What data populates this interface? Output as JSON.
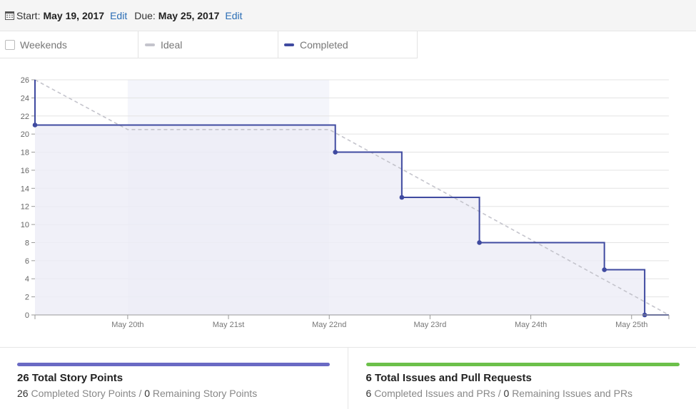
{
  "header": {
    "start_label": "Start:",
    "start_value": "May 19, 2017",
    "start_edit": "Edit",
    "due_label": "Due:",
    "due_value": "May 25, 2017",
    "due_edit": "Edit",
    "icon": "calendar-icon"
  },
  "legend": {
    "weekends": "Weekends",
    "ideal": "Ideal",
    "completed": "Completed"
  },
  "colors": {
    "completed": "#3f4aa0",
    "completed_fill": "#ececf6",
    "ideal": "#c4c4cc",
    "weekend_band": "#f4f5fb",
    "grid": "#e3e3e3",
    "story_bar": "#6a6ac4",
    "issues_bar": "#6cc04a"
  },
  "chart_data": {
    "type": "line",
    "y_ticks": [
      "0",
      "2",
      "4",
      "6",
      "8",
      "10",
      "12",
      "14",
      "16",
      "18",
      "20",
      "22",
      "24",
      "26"
    ],
    "x_ticks": [
      {
        "t": 1,
        "label": "May 20th"
      },
      {
        "t": 2,
        "label": "May 21st"
      },
      {
        "t": 3,
        "label": "May 22nd"
      },
      {
        "t": 4,
        "label": "May 23rd"
      },
      {
        "t": 5,
        "label": "May 24th"
      },
      {
        "t": 6,
        "label": "May 25th"
      }
    ],
    "xlim": [
      0.08,
      6.37
    ],
    "ylim": [
      0,
      26
    ],
    "weekend": [
      1,
      3
    ],
    "series": [
      {
        "name": "Completed",
        "step": true,
        "x": [
          0.08,
          0.08,
          3.06,
          3.72,
          4.49,
          5.73,
          6.13,
          6.37
        ],
        "y": [
          26,
          21,
          18,
          13,
          8,
          5,
          0,
          0
        ],
        "markers": [
          {
            "x": 0.08,
            "y": 21
          },
          {
            "x": 3.06,
            "y": 18
          },
          {
            "x": 3.72,
            "y": 13
          },
          {
            "x": 4.49,
            "y": 8
          },
          {
            "x": 5.73,
            "y": 5
          },
          {
            "x": 6.13,
            "y": 0
          }
        ]
      },
      {
        "name": "Ideal",
        "x": [
          0.08,
          1.0,
          3.0,
          6.37
        ],
        "y": [
          26,
          20.5,
          20.5,
          0
        ],
        "dashed": true
      }
    ],
    "grid": true
  },
  "stats": {
    "story": {
      "total_count": "26",
      "total_label": "Total Story Points",
      "completed_count": "26",
      "completed_label": "Completed Story Points",
      "separator": "/",
      "remaining_count": "0",
      "remaining_label": "Remaining Story Points"
    },
    "issues": {
      "total_count": "6",
      "total_label": "Total Issues and Pull Requests",
      "completed_count": "6",
      "completed_label": "Completed Issues and PRs",
      "separator": "/",
      "remaining_count": "0",
      "remaining_label": "Remaining Issues and PRs"
    }
  }
}
